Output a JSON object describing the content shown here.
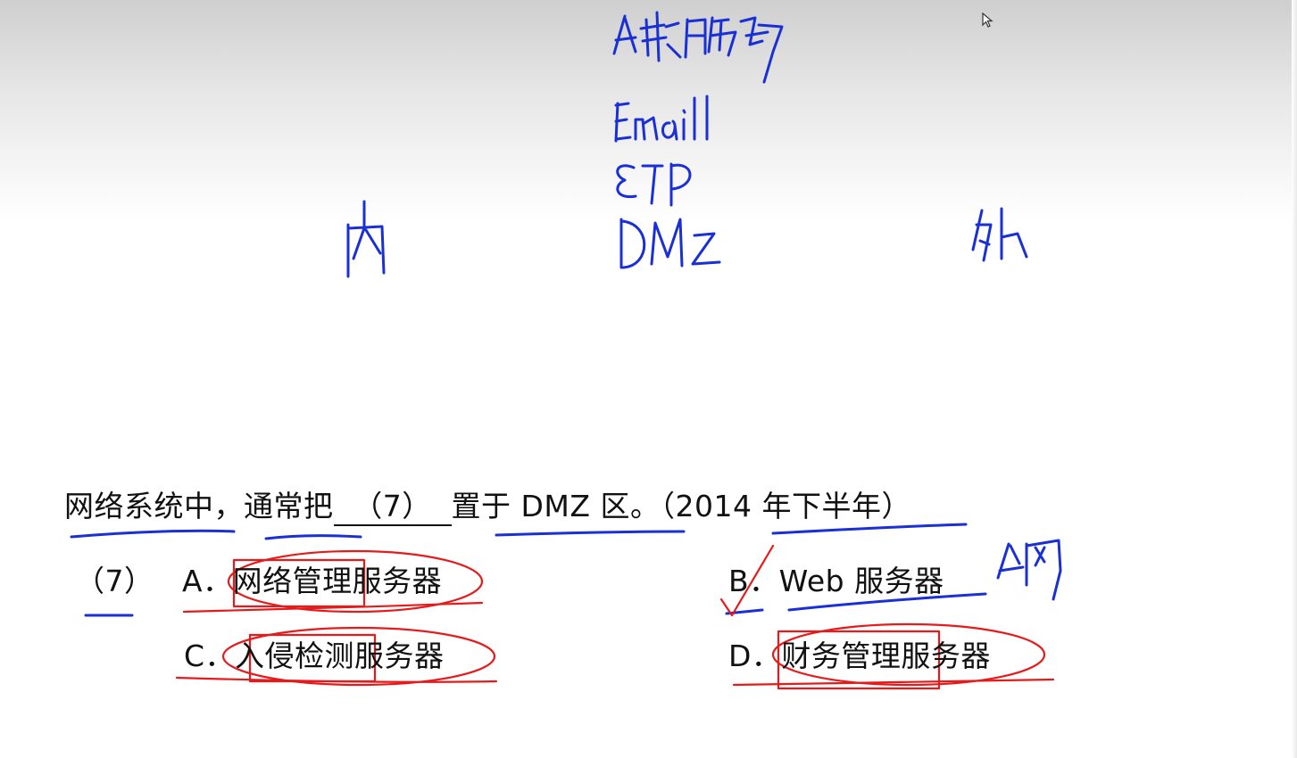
{
  "question": {
    "prefix": "网络系统中，通常把",
    "blank": "（7）",
    "suffix": "置于 DMZ 区。（2014 年下半年）"
  },
  "options": {
    "number": "（7）",
    "a": "A．网络管理服务器",
    "b": "B．Web 服务器",
    "c": "C．入侵检测服务器",
    "d": "D．财务管理服务器"
  },
  "annotations": {
    "ink_colors": {
      "blue": "#1a2fd6",
      "red": "#e61a1a"
    }
  }
}
